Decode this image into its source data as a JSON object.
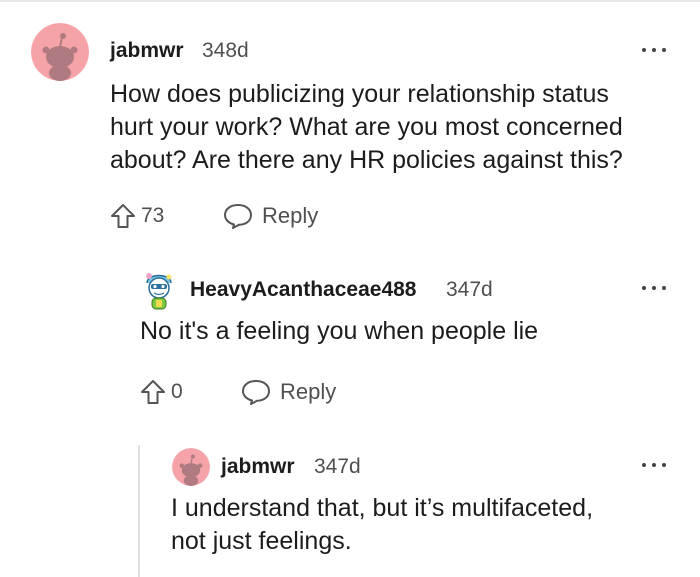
{
  "comments": [
    {
      "username": "jabmwr",
      "age": "348d",
      "body_lines": [
        "How does publicizing your relationship status",
        "hurt your work? What are you most concerned",
        "about? Are there any HR policies against this?"
      ],
      "votes": "73",
      "reply_label": "Reply",
      "avatar_icon": "snoo-avatar-pink"
    },
    {
      "username": "HeavyAcanthaceae488",
      "age": "347d",
      "body_lines": [
        "No it's a feeling you when people lie"
      ],
      "votes": "0",
      "reply_label": "Reply",
      "avatar_icon": "custom-snoo-avatar"
    },
    {
      "username": "jabmwr",
      "age": "347d",
      "body_lines": [
        "I understand that, but it’s multifaceted,",
        "not just feelings."
      ],
      "avatar_icon": "snoo-avatar-pink"
    }
  ],
  "colors": {
    "avatar_bg": "#f5a3a8",
    "text": "#1c1c1c",
    "meta": "#4f4f4f",
    "thread_line": "#e1e1e1"
  }
}
